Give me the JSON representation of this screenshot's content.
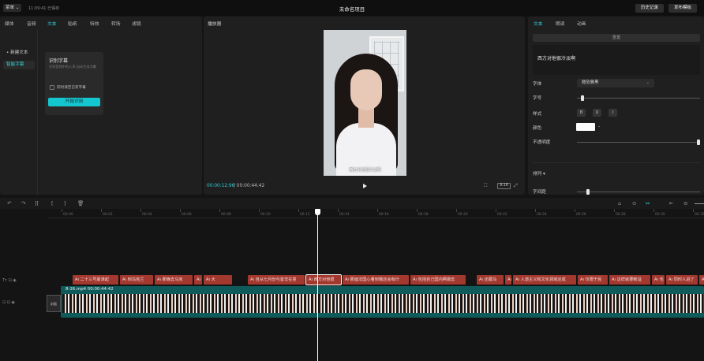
{
  "topbar": {
    "menu": "菜单",
    "time": "11:09:41",
    "saved": "已保存",
    "project_title": "未命名项目",
    "history_button": "历史记录",
    "publish_button": "发布模板"
  },
  "left_panel": {
    "tabs": [
      "媒体",
      "音频",
      "文本",
      "贴纸",
      "特效",
      "转场",
      "滤镜"
    ],
    "active_tab": "文本",
    "side_items": [
      "• 新建文本",
      "智能字幕"
    ],
    "recognize_card": {
      "title": "识别字幕",
      "description": "识别音频中的人声,自动生成字幕",
      "checkbox_label": "同时清空已有字幕",
      "button": "开始识别"
    }
  },
  "player": {
    "label": "播放器",
    "subtitle_overlay": "西方对他很冷淡啊",
    "current_time": "00:00:12:96",
    "separator": "/",
    "total_time": "00:00:44:42",
    "ratio": "9:16"
  },
  "right_panel": {
    "tabs": [
      "文本",
      "朗读",
      "动画"
    ],
    "active_tab": "文本",
    "reset": "重置",
    "text_content": "西方对他很冷淡啊",
    "font_label": "字体",
    "font_value": "微软雅黑",
    "size_label": "字号",
    "size_value": 0.03,
    "style_label": "样式",
    "style_buttons": [
      "B",
      "U",
      "I"
    ],
    "color_label": "颜色",
    "color_value": "#ffffff",
    "opacity_label": "不透明度",
    "opacity_value": 1.0,
    "arrange_label": "排列",
    "spacing_label": "字间距",
    "spacing_value": 0.08
  },
  "timeline": {
    "ruler_ticks": [
      "00:00",
      "00:02",
      "00:04",
      "00:06",
      "00:08",
      "00:10",
      "00:12",
      "00:14",
      "00:16",
      "00:18",
      "00:20",
      "00:22",
      "00:24",
      "00:26",
      "00:28",
      "00:30",
      "00:32"
    ],
    "subtitle_clips": [
      "二十三号嘉淮起",
      "到乌克兰",
      "那晚去乌克",
      "",
      "大",
      "自从七月份与昔非在意",
      "西方对他很",
      "那面法国心看到俄还会有什",
      "包括自己国内啊做去",
      "还跟乌",
      "",
      "人道主义和文化领域还成",
      "仅限于民",
      "这样就要断溢",
      "也",
      "同时人进了",
      "马"
    ],
    "video_track_label": "8-26.mp4 00:00:44:42",
    "cover_label": "封面"
  }
}
